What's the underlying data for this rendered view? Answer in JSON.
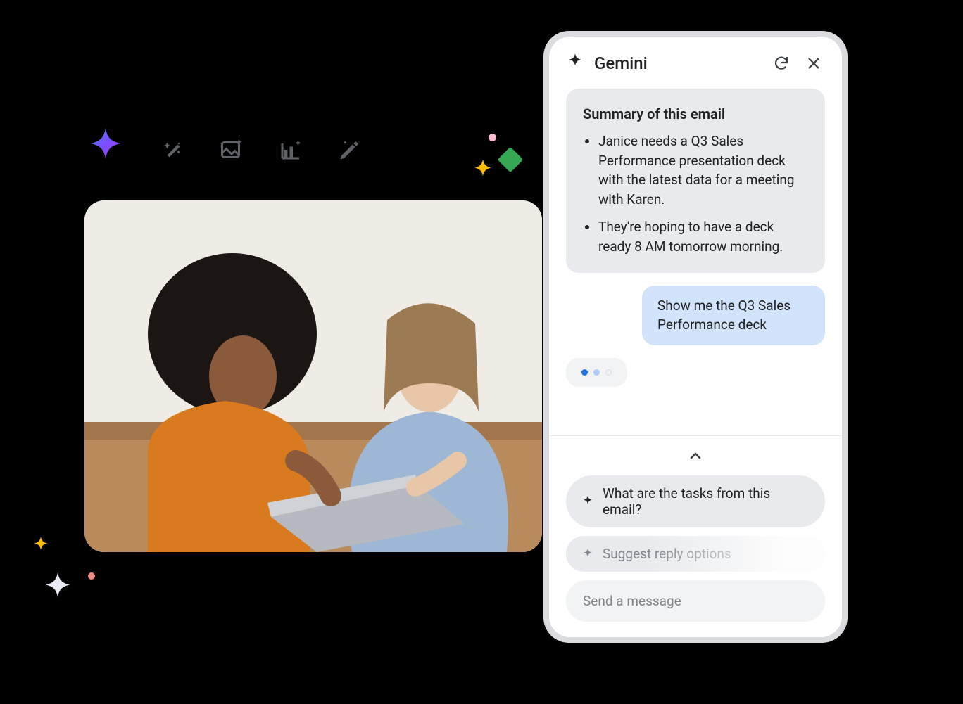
{
  "panel": {
    "title": "Gemini",
    "refresh_label": "Refresh",
    "close_label": "Close",
    "summary": {
      "heading": "Summary of this email",
      "bullets": [
        "Janice needs a Q3 Sales Performance presentation deck with the latest data for a meeting with Karen.",
        "They're hoping to have a deck ready 8 AM tomorrow morning."
      ]
    },
    "user_message": "Show me the Q3 Sales Performance deck",
    "typing_indicator": true,
    "suggestions": [
      "What are the tasks from this email?",
      "Suggest reply options"
    ],
    "composer_placeholder": "Send a message"
  },
  "toolbar": {
    "icons": [
      "sparkle-icon",
      "magic-wand-icon",
      "image-sparkle-icon",
      "chart-sparkle-icon",
      "pen-sparkle-icon"
    ]
  },
  "photo": {
    "alt": "Two women sitting on a couch collaborating over a laptop"
  },
  "colors": {
    "ai_card_bg": "#e8eaed",
    "user_card_bg": "#d2e3fc",
    "text": "#202124",
    "muted": "#80868b"
  }
}
